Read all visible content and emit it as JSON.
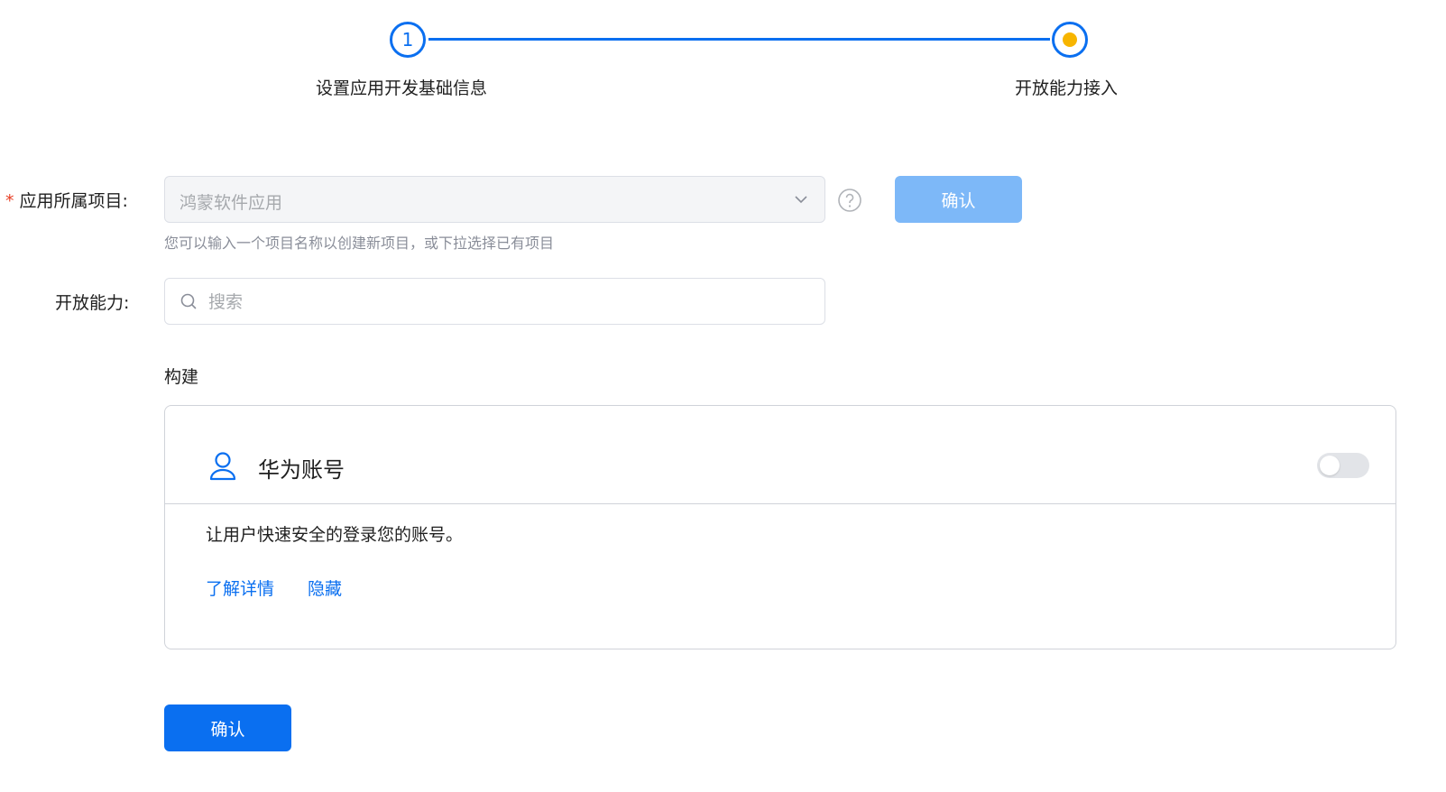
{
  "stepper": {
    "steps": [
      {
        "number": "1",
        "label": "设置应用开发基础信息",
        "state": "completed"
      },
      {
        "number": "",
        "label": "开放能力接入",
        "state": "current"
      }
    ],
    "accent_color": "#0a6ff0",
    "current_dot_color": "#f7b500"
  },
  "form": {
    "project": {
      "required_mark": "*",
      "label": "应用所属项目:",
      "value": "鸿蒙软件应用",
      "help_icon": "question-circle-icon",
      "hint": "您可以输入一个项目名称以创建新项目，或下拉选择已有项目",
      "confirm_label": "确认"
    },
    "capability": {
      "label": "开放能力:",
      "search_placeholder": "搜索",
      "search_value": ""
    }
  },
  "section": {
    "title": "构建",
    "cards": [
      {
        "icon": "user-icon",
        "title": "华为账号",
        "enabled": false,
        "description": "让用户快速安全的登录您的账号。",
        "learn_more": "了解详情",
        "hide": "隐藏"
      }
    ]
  },
  "footer": {
    "confirm_label": "确认"
  }
}
